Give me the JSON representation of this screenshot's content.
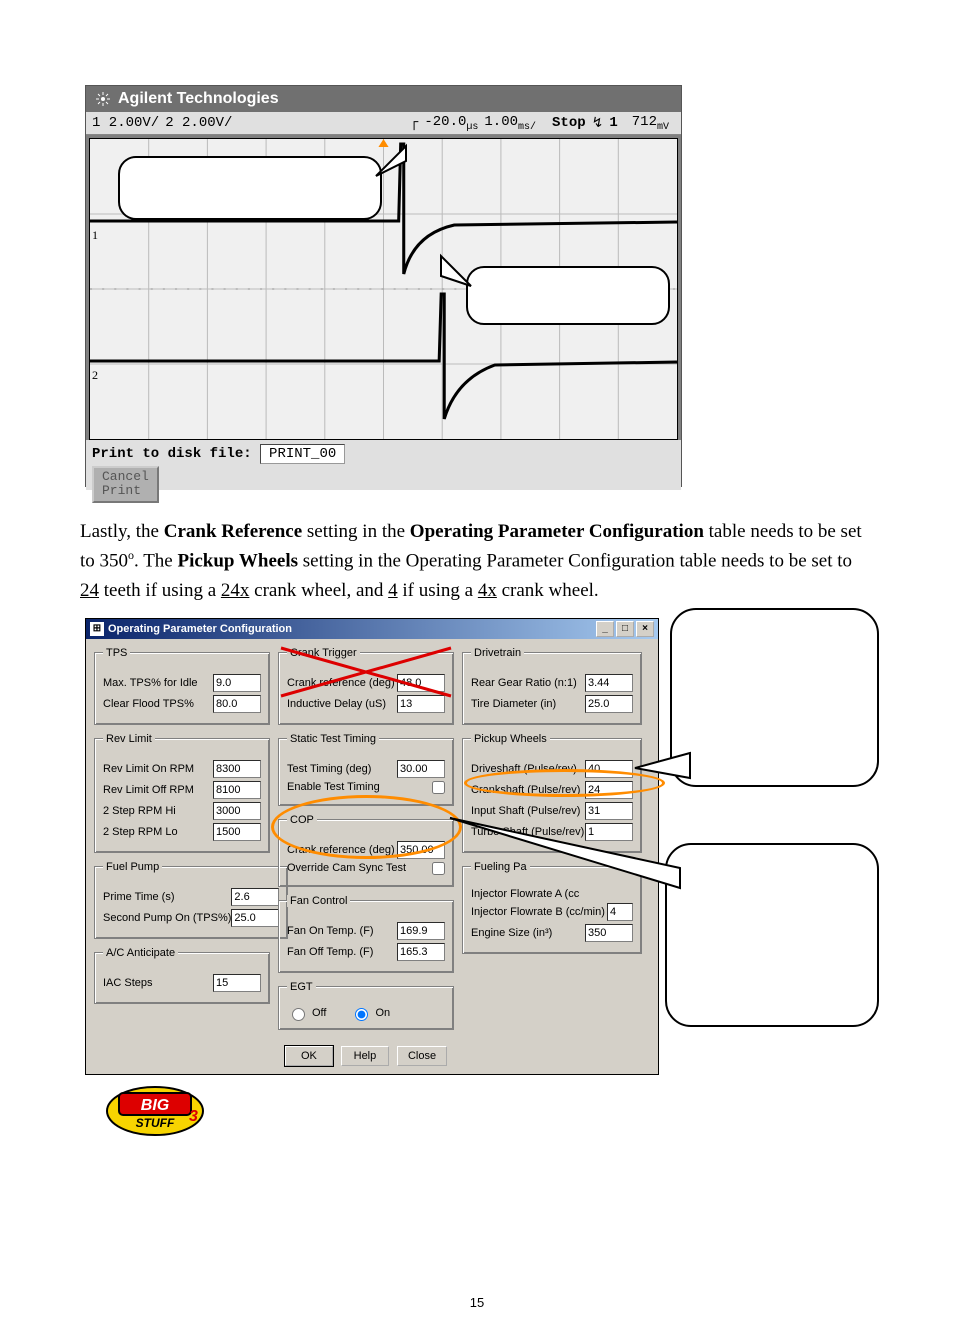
{
  "scope": {
    "brand": "Agilent Technologies",
    "ch1_scale": "1 2.00V/",
    "ch2_scale": "2 2.00V/",
    "delay": "-20.0",
    "delay_unit": "µs",
    "timebase": "1.00",
    "timebase_unit": "ms/",
    "mode": "Stop",
    "trig_ch": "1",
    "trig_level": "712",
    "trig_unit": "mV",
    "print_label": "Print to disk file:",
    "print_file": "PRINT_00",
    "cancel_print": "Cancel\nPrint",
    "callout1": "",
    "callout2": ""
  },
  "paragraph": {
    "t1": "Lastly, the ",
    "b1": "Crank Reference",
    "t2": " setting in the ",
    "b2": "Operating Parameter Configuration",
    "t3": " table needs to be set to 350",
    "deg": "o",
    "t4": ". The ",
    "b3": "Pickup Wheels",
    "t5": " setting in the Operating Parameter Configuration table needs to be set to ",
    "u1": "24",
    "t6": " teeth if using a ",
    "u2": "24x",
    "t7": " crank wheel, and ",
    "u3": "4",
    "t8": " if using a ",
    "u4": "4x",
    "t9": " crank wheel."
  },
  "dialog": {
    "title": "Operating Parameter Configuration",
    "tps": {
      "legend": "TPS",
      "max_tps_idle_lbl": "Max. TPS% for Idle",
      "max_tps_idle_val": "9.0",
      "clear_flood_lbl": "Clear Flood TPS%",
      "clear_flood_val": "80.0"
    },
    "rev": {
      "legend": "Rev Limit",
      "on_lbl": "Rev Limit On RPM",
      "on_val": "8300",
      "off_lbl": "Rev Limit Off RPM",
      "off_val": "8100",
      "hi_lbl": "2 Step RPM Hi",
      "hi_val": "3000",
      "lo_lbl": "2 Step RPM Lo",
      "lo_val": "1500"
    },
    "fuelpump": {
      "legend": "Fuel Pump",
      "prime_lbl": "Prime Time (s)",
      "prime_val": "2.6",
      "second_lbl": "Second Pump On (TPS%)",
      "second_val": "25.0"
    },
    "ac": {
      "legend": "A/C Anticipate",
      "iac_lbl": "IAC Steps",
      "iac_val": "15"
    },
    "crank": {
      "legend": "Crank Trigger",
      "ref_lbl": "Crank reference (deg)",
      "ref_val": "48.0",
      "delay_lbl": "Inductive Delay (uS)",
      "delay_val": "13"
    },
    "static": {
      "legend": "Static Test Timing",
      "timing_lbl": "Test Timing (deg)",
      "timing_val": "30.00",
      "enable_lbl": "Enable Test Timing"
    },
    "cop": {
      "legend": "COP",
      "ref_lbl": "Crank reference (deg)",
      "ref_val": "350.00",
      "override_lbl": "Override Cam Sync Test"
    },
    "fan": {
      "legend": "Fan Control",
      "on_lbl": "Fan On Temp. (F)",
      "on_val": "169.9",
      "off_lbl": "Fan Off Temp. (F)",
      "off_val": "165.3"
    },
    "egt": {
      "legend": "EGT",
      "off": "Off",
      "on": "On"
    },
    "drivetrain": {
      "legend": "Drivetrain",
      "gear_lbl": "Rear Gear Ratio (n:1)",
      "gear_val": "3.44",
      "tire_lbl": "Tire Diameter (in)",
      "tire_val": "25.0"
    },
    "pickup": {
      "legend": "Pickup Wheels",
      "drive_lbl": "Driveshaft (Pulse/rev)",
      "drive_val": "40",
      "crank_lbl": "Crankshaft (Pulse/rev)",
      "crank_val": "24",
      "input_lbl": "Input Shaft (Pulse/rev)",
      "input_val": "31",
      "turbo_lbl": "Turbo Shaft (Pulse/rev)",
      "turbo_val": "1"
    },
    "fueling": {
      "legend": "Fueling Pa",
      "inj_a_lbl": "Injector Flowrate A (cc",
      "inj_b_lbl": "Injector Flowrate B (cc/min)",
      "inj_b_val": "4",
      "eng_lbl": "Engine Size (in³)",
      "eng_val": "350"
    },
    "buttons": {
      "ok": "OK",
      "help": "Help",
      "close": "Close"
    }
  },
  "note_callouts": {
    "a": "",
    "b": ""
  },
  "page_number": "15"
}
